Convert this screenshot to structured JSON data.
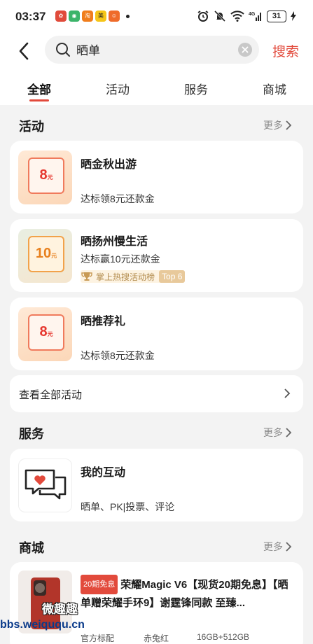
{
  "status_bar": {
    "time": "03:37",
    "apps": [
      {
        "name": "app-icon-1",
        "color": "#e04b3b"
      },
      {
        "name": "app-icon-2",
        "color": "#3bb46a"
      },
      {
        "name": "app-icon-3",
        "color": "#f07d1c"
      },
      {
        "name": "app-icon-4",
        "color": "#f5c518"
      },
      {
        "name": "app-icon-5",
        "color": "#ef6b2a"
      }
    ],
    "network": "4G",
    "battery": "31"
  },
  "search": {
    "query": "晒单",
    "button_label": "搜索"
  },
  "tabs": [
    "全部",
    "活动",
    "服务",
    "商城"
  ],
  "activity_section": {
    "title": "活动",
    "more": "更多",
    "items": [
      {
        "title": "晒金秋出游",
        "desc": "达标领8元还款金",
        "voucher": "8",
        "voucher_unit": "元"
      },
      {
        "title": "晒扬州慢生活",
        "desc": "达标赢10元还款金",
        "voucher": "10",
        "voucher_unit": "元",
        "tag": "掌上热搜活动榜",
        "tag_rank": "Top 6"
      },
      {
        "title": "晒推荐礼",
        "desc": "达标领8元还款金",
        "voucher": "8",
        "voucher_unit": "元"
      }
    ],
    "view_all": "查看全部活动"
  },
  "service_section": {
    "title": "服务",
    "more": "更多",
    "item": {
      "title": "我的互动",
      "desc": "晒单、PK|投票、评论"
    }
  },
  "mall_section": {
    "title": "商城",
    "more": "更多",
    "product": {
      "badge": "20期免息",
      "title": "荣耀Magic V6【现货20期免息】【晒单赠荣耀手环9】谢霆锋同款 至臻...",
      "specs": [
        "官方标配",
        "赤兔红",
        "16GB+512GB"
      ]
    }
  },
  "watermark": {
    "site": "bbs.weiququ.cn",
    "brand": "微趣趣"
  },
  "colors": {
    "accent": "#e24a3c",
    "background": "#f3f3f3",
    "card": "#ffffff"
  }
}
